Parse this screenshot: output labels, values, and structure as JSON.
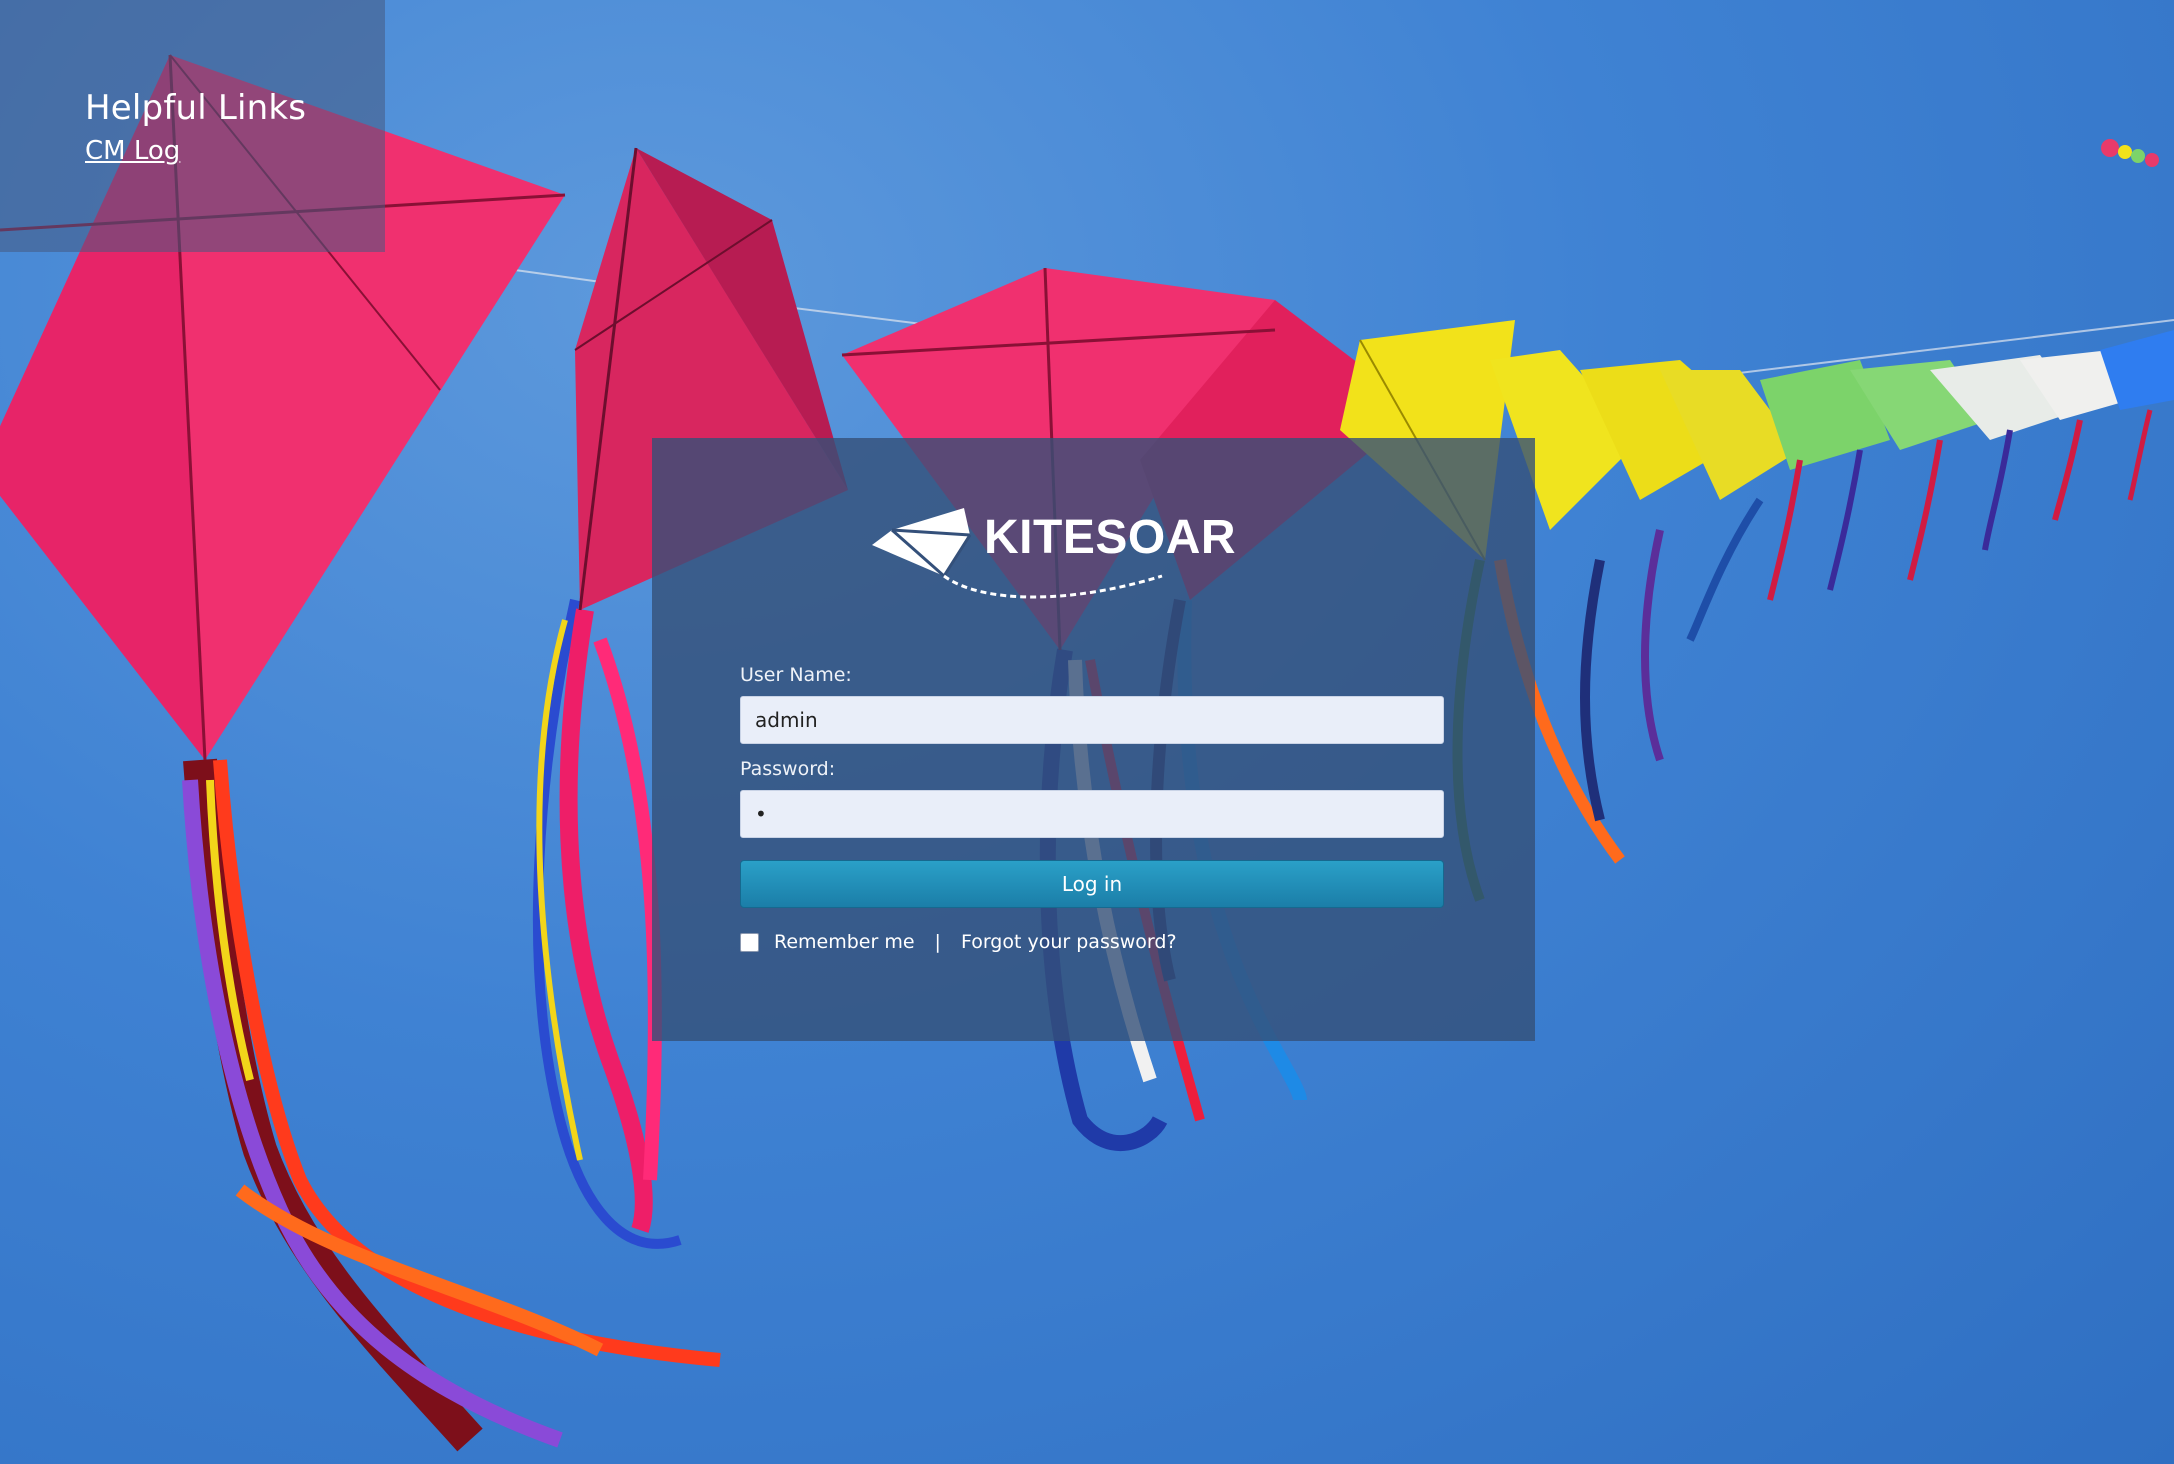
{
  "helpful_links": {
    "title": "Helpful Links",
    "links": [
      {
        "label": "CM Log"
      }
    ]
  },
  "brand": {
    "name": "KITESOAR"
  },
  "login_form": {
    "username_label": "User Name:",
    "username_value": "admin",
    "password_label": "Password:",
    "password_value": "•",
    "login_button": "Log in",
    "remember_me": "Remember me",
    "remember_checked": false,
    "separator": "|",
    "forgot_password": "Forgot your password?"
  },
  "colors": {
    "sky": "#3f82d3",
    "panel": "#34507a",
    "button": "#1f8bb5",
    "kite_pink": "#f0306f",
    "kite_yellow": "#f2e21a",
    "kite_green": "#7cd36a"
  }
}
